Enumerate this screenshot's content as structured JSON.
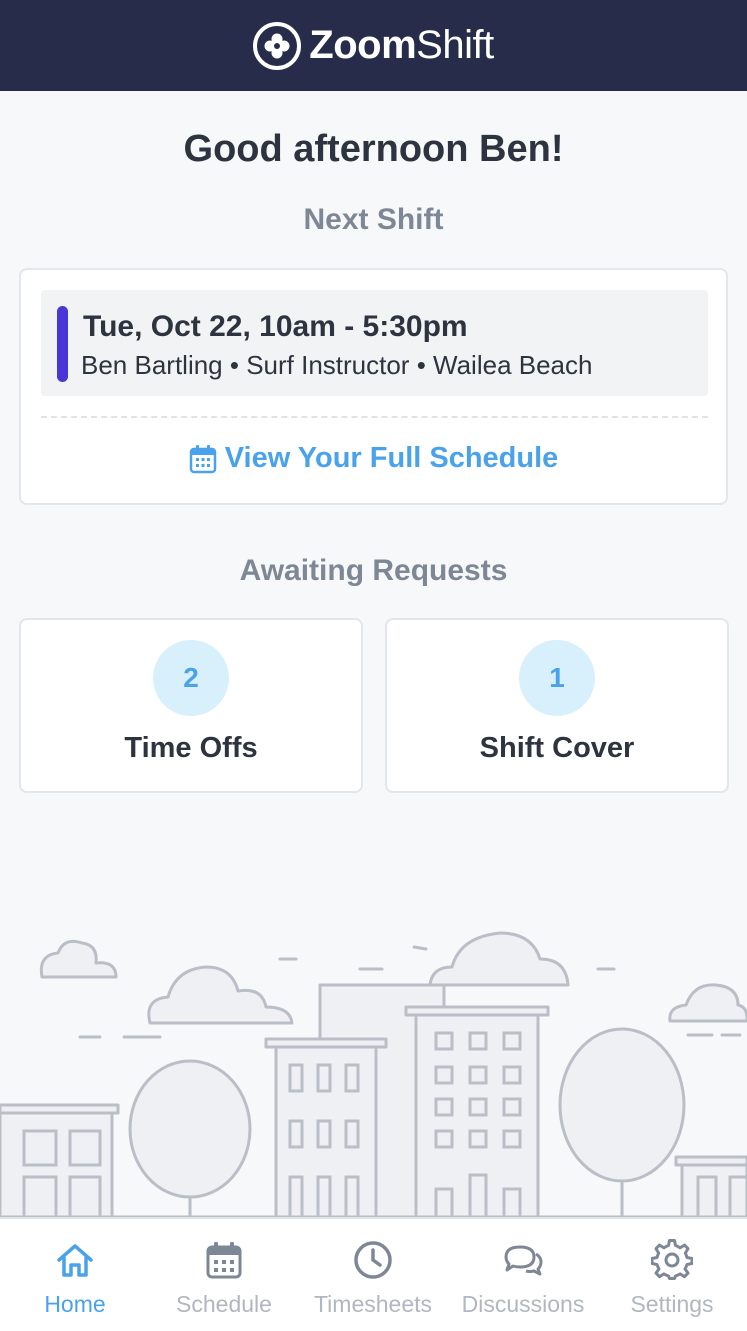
{
  "header": {
    "brand_bold": "Zoom",
    "brand_light": "Shift",
    "logo_icon": "zoomshift-logo-icon",
    "background_color": "#262c4a"
  },
  "greeting": "Good afternoon Ben!",
  "next_shift": {
    "title": "Next Shift",
    "time": "Tue, Oct 22, 10am - 5:30pm",
    "details": "Ben Bartling • Surf Instructor • Wailea Beach",
    "bar_color": "#4a35d8",
    "view_link": "View Your Full Schedule",
    "view_link_icon": "calendar-icon"
  },
  "awaiting": {
    "title": "Awaiting Requests",
    "items": [
      {
        "count": "2",
        "label": "Time Offs"
      },
      {
        "count": "1",
        "label": "Shift Cover"
      }
    ]
  },
  "tabs": [
    {
      "label": "Home",
      "icon": "home-icon",
      "active": true
    },
    {
      "label": "Schedule",
      "icon": "calendar-icon",
      "active": false
    },
    {
      "label": "Timesheets",
      "icon": "clock-icon",
      "active": false
    },
    {
      "label": "Discussions",
      "icon": "chat-bubbles-icon",
      "active": false
    },
    {
      "label": "Settings",
      "icon": "gear-icon",
      "active": false
    }
  ],
  "colors": {
    "accent": "#4aa3ea",
    "text": "#2d3440",
    "muted": "#7e8795",
    "illustration": "#b9bec7"
  }
}
